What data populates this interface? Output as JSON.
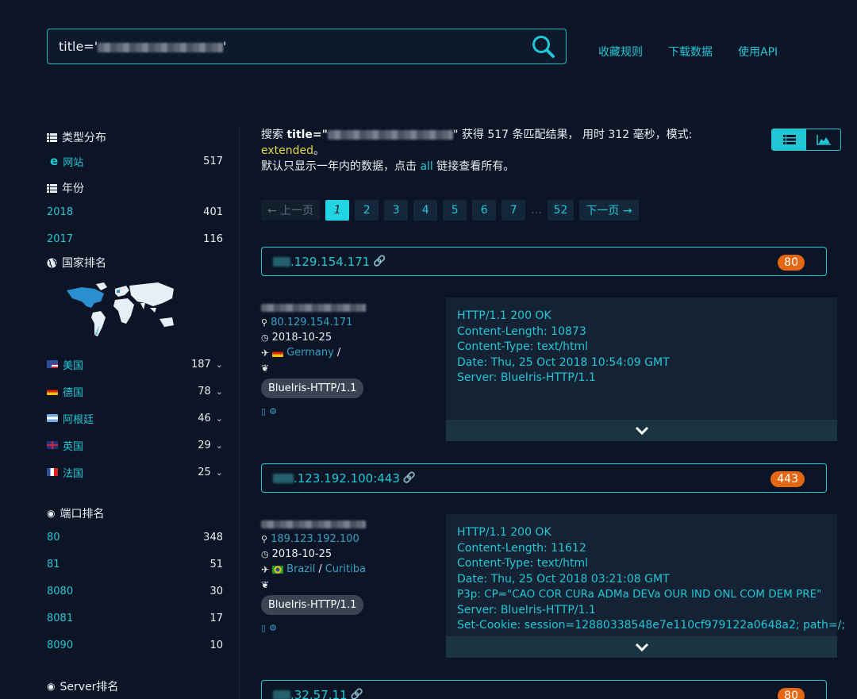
{
  "search": {
    "query_prefix": "title='",
    "query_suffix": "'"
  },
  "top_links": [
    "收藏规则",
    "下载数据",
    "使用API"
  ],
  "sidebar": {
    "type_title": "类型分布",
    "type_items": [
      {
        "label": "网站",
        "count": "517"
      }
    ],
    "year_title": "年份",
    "year_items": [
      {
        "label": "2018",
        "count": "401"
      },
      {
        "label": "2017",
        "count": "116"
      }
    ],
    "country_title": "国家排名",
    "country_items": [
      {
        "label": "美国",
        "count": "187"
      },
      {
        "label": "德国",
        "count": "78"
      },
      {
        "label": "阿根廷",
        "count": "46"
      },
      {
        "label": "英国",
        "count": "29"
      },
      {
        "label": "法国",
        "count": "25"
      }
    ],
    "port_title": "端口排名",
    "port_items": [
      {
        "label": "80",
        "count": "348"
      },
      {
        "label": "81",
        "count": "51"
      },
      {
        "label": "8080",
        "count": "30"
      },
      {
        "label": "8081",
        "count": "17"
      },
      {
        "label": "8090",
        "count": "10"
      }
    ],
    "server_title": "Server排名"
  },
  "summary": {
    "prefix": "搜索 ",
    "query_label": "title=\"",
    "query_close": "\"",
    "middle": " 获得 517 条匹配结果， 用时 312 毫秒，模式:",
    "mode": "extended",
    "mode_end": "。",
    "line2_a": "默认只显示一年内的数据，点击 ",
    "line2_link": "all",
    "line2_b": " 链接查看所有。"
  },
  "pager": {
    "prev": "← 上一页",
    "pages": [
      "1",
      "2",
      "3",
      "4",
      "5",
      "6",
      "7"
    ],
    "dots": "...",
    "last": "52",
    "next": "下一页 →"
  },
  "results": [
    {
      "host": ".129.154.171",
      "port": "80",
      "ip": "80.129.154.171",
      "date": "2018-10-25",
      "country": "Germany",
      "city": "",
      "sep": " /",
      "server_badge": "BlueIris-HTTP/1.1",
      "banner": [
        "HTTP/1.1 200 OK",
        "Content-Length: 10873",
        "Content-Type: text/html",
        "Date: Thu, 25 Oct 2018 10:54:09 GMT",
        "Server: BlueIris-HTTP/1.1"
      ]
    },
    {
      "host": ".123.192.100:443",
      "port": "443",
      "ip": "189.123.192.100",
      "date": "2018-10-25",
      "country": "Brazil",
      "city": "Curitiba",
      "sep": " / ",
      "server_badge": "BlueIris-HTTP/1.1",
      "banner": [
        "HTTP/1.1 200 OK",
        "Content-Length: 11612",
        "Content-Type: text/html",
        "Date: Thu, 25 Oct 2018 03:21:08 GMT",
        "P3p: CP=\"CAO COR CURa ADMa DEVa OUR IND ONL COM DEM PRE\"",
        "Server: BlueIris-HTTP/1.1",
        "Set-Cookie: session=12880338548e7e110cf979122a0648a2; path=/;"
      ]
    },
    {
      "host": ".32.57.11",
      "port": "80"
    }
  ],
  "colors": {
    "accent": "#22c7d6",
    "port_badge": "#e56713",
    "mode": "#e3d64a"
  }
}
